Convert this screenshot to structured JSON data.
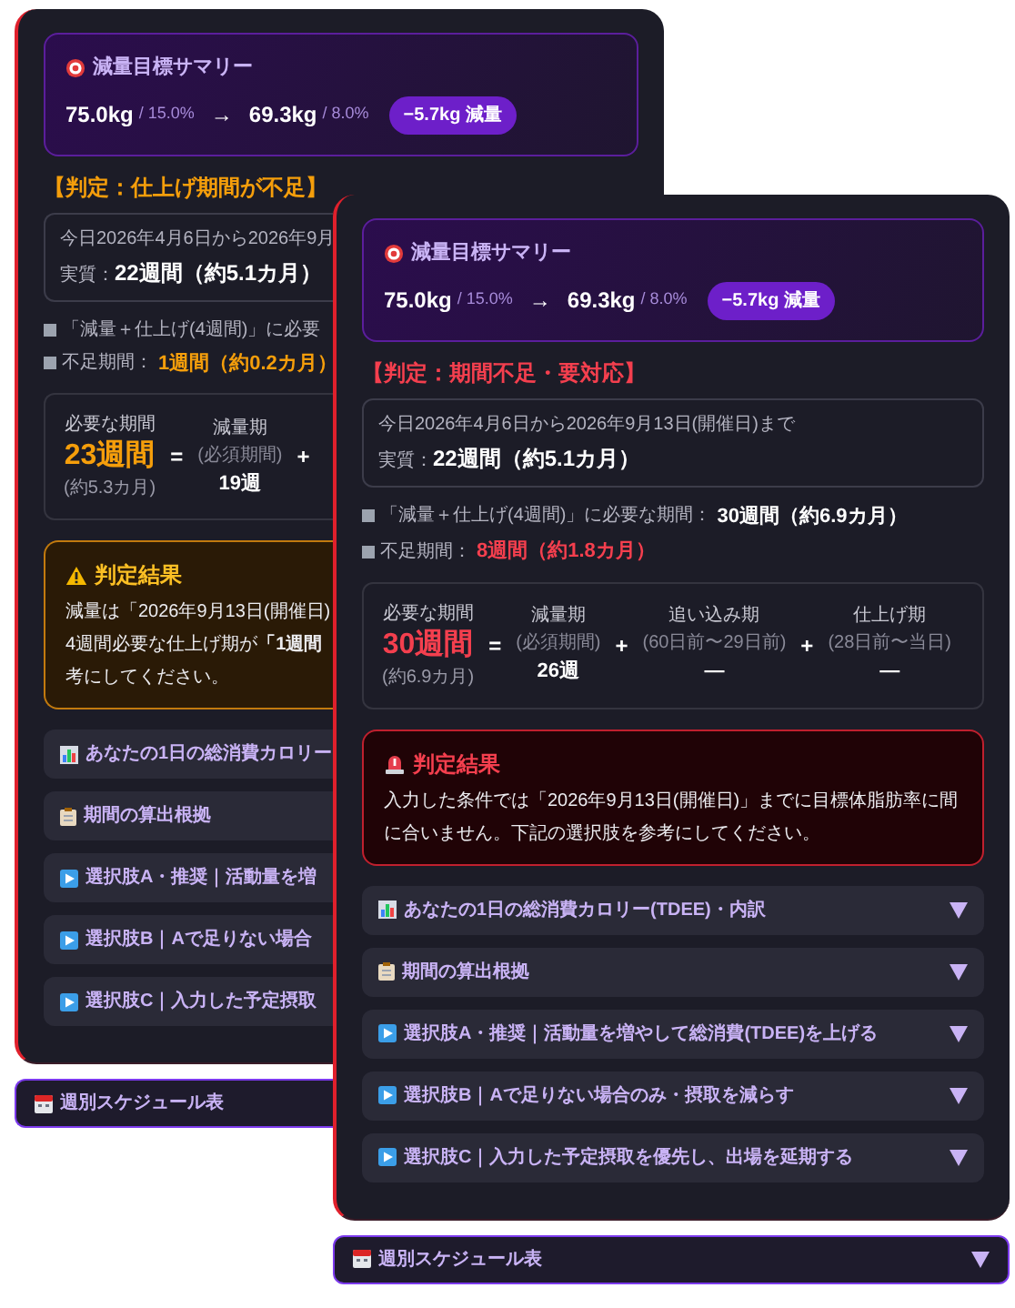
{
  "panels": [
    {
      "summary": {
        "title": "減量目標サマリー",
        "start_weight": "75.0kg",
        "start_fat": "/ 15.0%",
        "arrow": "→",
        "goal_weight": "69.3kg",
        "goal_fat": "/ 8.0%",
        "badge": "−5.7kg 減量"
      },
      "verdict": {
        "color": "#f59e0b",
        "text": "【判定：仕上げ期間が不足】"
      },
      "period": {
        "range": "今日2026年4月6日から2026年9月",
        "label": "実質：",
        "value": "22週間（約5.1カ月）"
      },
      "bullets": [
        {
          "label": "「減量＋仕上げ(4週間)」に必要"
        },
        {
          "label": "不足期間：",
          "value": "1週間（約0.2カ月）",
          "color": "#f59e0b"
        }
      ],
      "breakdown": {
        "label": "必要な期間",
        "total": "23週間",
        "total_sub": "(約5.3カ月)",
        "color": "#f59e0b",
        "terms": [
          {
            "op": "=",
            "name": "減量期",
            "sub": "(必須期間)",
            "value": "19週"
          },
          {
            "op": "+"
          }
        ]
      },
      "result": {
        "kind": "warning",
        "title": "判定結果",
        "lines": [
          "減量は「2026年9月13日(開催日)",
          "4週間必要な仕上げ期が**「1週間**",
          "考にしてください。"
        ]
      },
      "accordions": [
        {
          "kind": "chart",
          "label": "あなたの1日の総消費カロリー"
        },
        {
          "kind": "clipboard",
          "label": "期間の算出根拠"
        },
        {
          "kind": "play",
          "label": "選択肢A・推奨｜活動量を増"
        },
        {
          "kind": "play",
          "label": "選択肢B｜Aで足りない場合"
        },
        {
          "kind": "play",
          "label": "選択肢C｜入力した予定摂取"
        }
      ],
      "schedule": {
        "label": "週別スケジュール表"
      }
    },
    {
      "summary": {
        "title": "減量目標サマリー",
        "start_weight": "75.0kg",
        "start_fat": "/ 15.0%",
        "arrow": "→",
        "goal_weight": "69.3kg",
        "goal_fat": "/ 8.0%",
        "badge": "−5.7kg 減量"
      },
      "verdict": {
        "color": "#f43f4e",
        "text": "【判定：期間不足・要対応】"
      },
      "period": {
        "range": "今日2026年4月6日から2026年9月13日(開催日)まで",
        "label": "実質：",
        "value": "22週間（約5.1カ月）"
      },
      "bullets": [
        {
          "label": "「減量＋仕上げ(4週間)」に必要な期間：",
          "value": "30週間（約6.9カ月）",
          "color": "#ffffff"
        },
        {
          "label": "不足期間：",
          "value": "8週間（約1.8カ月）",
          "color": "#f43f4e"
        }
      ],
      "breakdown": {
        "label": "必要な期間",
        "total": "30週間",
        "total_sub": "(約6.9カ月)",
        "color": "#f43f4e",
        "terms": [
          {
            "op": "=",
            "name": "減量期",
            "sub": "(必須期間)",
            "value": "26週"
          },
          {
            "op": "+",
            "name": "追い込み期",
            "sub": "(60日前〜29日前)",
            "value": "—"
          },
          {
            "op": "+",
            "name": "仕上げ期",
            "sub": "(28日前〜当日)",
            "value": "—"
          }
        ]
      },
      "result": {
        "kind": "danger",
        "title": "判定結果",
        "lines": [
          "入力した条件では「2026年9月13日(開催日)」までに目標体脂肪率に間",
          "に合いません。下記の選択肢を参考にしてください。"
        ]
      },
      "accordions": [
        {
          "kind": "chart",
          "label": "あなたの1日の総消費カロリー(TDEE)・内訳",
          "expanded": false
        },
        {
          "kind": "clipboard",
          "label": "期間の算出根拠",
          "expanded": false
        },
        {
          "kind": "play",
          "label": "選択肢A・推奨｜活動量を増やして総消費(TDEE)を上げる",
          "expanded": false
        },
        {
          "kind": "play",
          "label": "選択肢B｜Aで足りない場合のみ・摂取を減らす",
          "expanded": false
        },
        {
          "kind": "play",
          "label": "選択肢C｜入力した予定摂取を優先し、出場を延期する",
          "expanded": false
        }
      ],
      "schedule": {
        "label": "週別スケジュール表",
        "expanded": false
      }
    }
  ]
}
